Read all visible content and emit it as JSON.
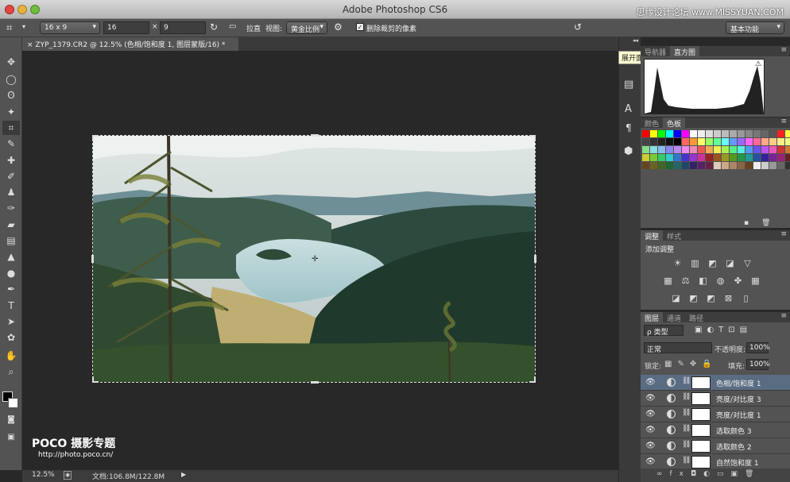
{
  "window": {
    "title": "Adobe Photoshop CS6",
    "watermark_top": "思缘设计论坛 www.MISSYUAN.COM"
  },
  "options_bar": {
    "ratio_preset": "16 x 9",
    "width_value": "16",
    "times": "×",
    "height_value": "9",
    "straighten_label": "拉直",
    "view_label": "视图:",
    "view_value": "黄金比例",
    "delete_cropped_label": "删除裁剪的像素",
    "workspace": "基本功能"
  },
  "document": {
    "tab_title": "ZYP_1379.CR2 @ 12.5% (色相/饱和度 1, 图层蒙版/16) *"
  },
  "status": {
    "zoom": "12.5%",
    "doc_info": "文档:106.8M/122.8M"
  },
  "watermark": {
    "brand": "POCO 摄影专题",
    "url": "http://photo.poco.cn/"
  },
  "tooltip": "展开面板",
  "histogram_panel": {
    "tabs": [
      "导航器",
      "直方图"
    ],
    "active": 1
  },
  "swatch_panel": {
    "tabs": [
      "颜色",
      "色板"
    ],
    "active": 1
  },
  "adjust_panel": {
    "tabs": [
      "调整",
      "样式"
    ],
    "active": 0,
    "heading": "添加调整"
  },
  "layers_panel": {
    "tabs": [
      "图层",
      "通道",
      "路径"
    ],
    "active": 0,
    "filter_label": "ρ 类型",
    "blend_mode": "正常",
    "opacity_label": "不透明度:",
    "opacity_value": "100%",
    "lock_label": "锁定:",
    "fill_label": "填充:",
    "fill_value": "100%",
    "layers": [
      "色相/饱和度 1",
      "亮度/对比度 3",
      "亮度/对比度 1",
      "选取颜色 3",
      "选取颜色 2",
      "自然饱和度 1"
    ]
  },
  "colors": {
    "ui_bg": "#535353",
    "canvas_bg": "#282828",
    "selected_layer": "#5a6c82"
  }
}
